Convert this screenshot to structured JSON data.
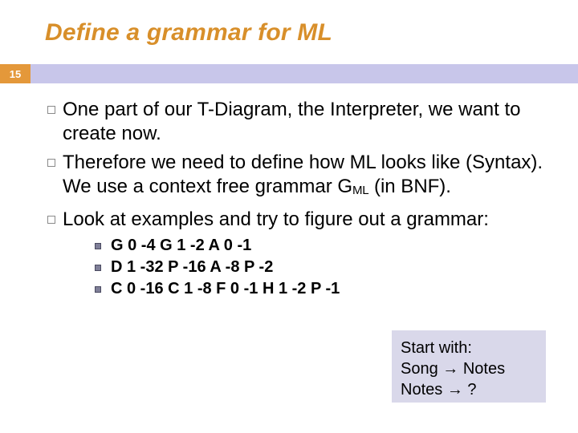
{
  "title": "Define a grammar for ML",
  "page_number": "15",
  "bullets": [
    {
      "text": "One part of our T-Diagram, the Interpreter, we want to create now."
    },
    {
      "text": "Therefore we need to define how ML looks like (Syntax). We use a context free grammar ",
      "gprefix": "G",
      "gsub": "ML",
      "tail": " (in BNF)."
    },
    {
      "text": "Look at examples and try to figure out a grammar:"
    }
  ],
  "examples": [
    "G 0 -4  G 1 -2  A 0 -1",
    "D 1 -32  P -16  A -8  P -2",
    "C 0 -16  C 1 -8  F 0 -1  H 1 -2  P -1"
  ],
  "hint": {
    "line1": "Start with:",
    "line2_a": "Song ",
    "line2_b": " Notes",
    "line3_a": "Notes ",
    "line3_b": " ?",
    "arrow": "→"
  }
}
